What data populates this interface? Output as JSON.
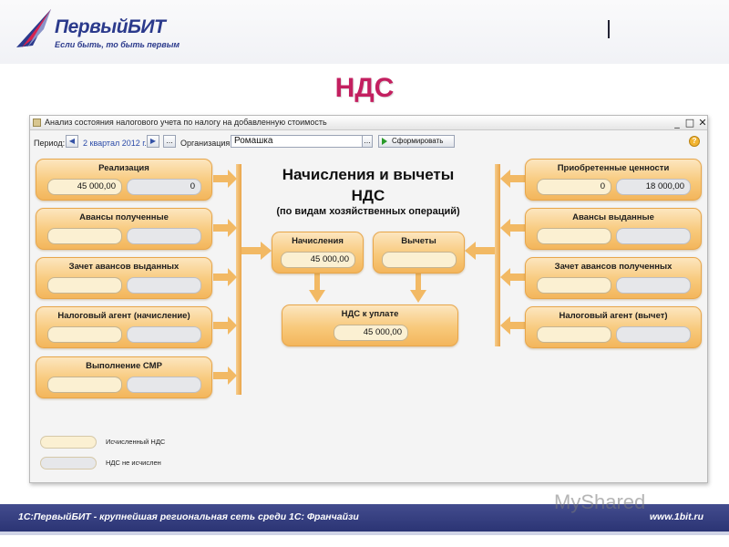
{
  "header": {
    "logo_title": "ПервыйБИТ",
    "logo_slogan": "Если быть, то быть первым",
    "slide_title": "НДС"
  },
  "window": {
    "title": "Анализ состояния налогового учета по налогу на добавленную стоимость",
    "controls": [
      "_",
      "□",
      "✕"
    ]
  },
  "toolbar": {
    "period_label": "Период:",
    "period_value": "2 квартал 2012 г.",
    "ellipsis": "...",
    "org_label": "Организация:",
    "org_value": "Ромашка",
    "run_label": "Сформировать",
    "help": "?"
  },
  "diagram": {
    "title_line1": "Начисления и вычеты",
    "title_line2": "НДС",
    "title_line3": "(по видам хозяйственных операций)",
    "left_boxes": [
      {
        "label": "Реализация",
        "value1": "45 000,00",
        "value2": "0"
      },
      {
        "label": "Авансы полученные",
        "value1": "",
        "value2": ""
      },
      {
        "label": "Зачет авансов выданных",
        "value1": "",
        "value2": ""
      },
      {
        "label": "Налоговый агент (начисление)",
        "value1": "",
        "value2": ""
      },
      {
        "label": "Выполнение СМР",
        "value1": "",
        "value2": ""
      }
    ],
    "right_boxes": [
      {
        "label": "Приобретенные ценности",
        "value1": "0",
        "value2": "18 000,00"
      },
      {
        "label": "Авансы выданные",
        "value1": "",
        "value2": ""
      },
      {
        "label": "Зачет авансов полученных",
        "value1": "",
        "value2": ""
      },
      {
        "label": "Налоговый агент (вычет)",
        "value1": "",
        "value2": ""
      }
    ],
    "accruals": {
      "label": "Начисления",
      "value": "45 000,00"
    },
    "deductions": {
      "label": "Вычеты",
      "value": ""
    },
    "payable": {
      "label": "НДС к уплате",
      "value": "45 000,00"
    }
  },
  "legend": {
    "calculated": "Исчисленный НДС",
    "not_calculated": "НДС не исчислен",
    "colors": {
      "calculated": "#fbf0d2",
      "not_calculated": "#e6e7ea"
    }
  },
  "footer": {
    "left": "1С:ПервыйБИТ - крупнейшая региональная сеть среди 1С: Франчайзи",
    "right": "www.1bit.ru"
  },
  "watermark": "MyShared",
  "colors": {
    "brand": "#2b3a8c",
    "title": "#c32060",
    "box": "#f8c97b",
    "arrow": "#f0b560"
  }
}
